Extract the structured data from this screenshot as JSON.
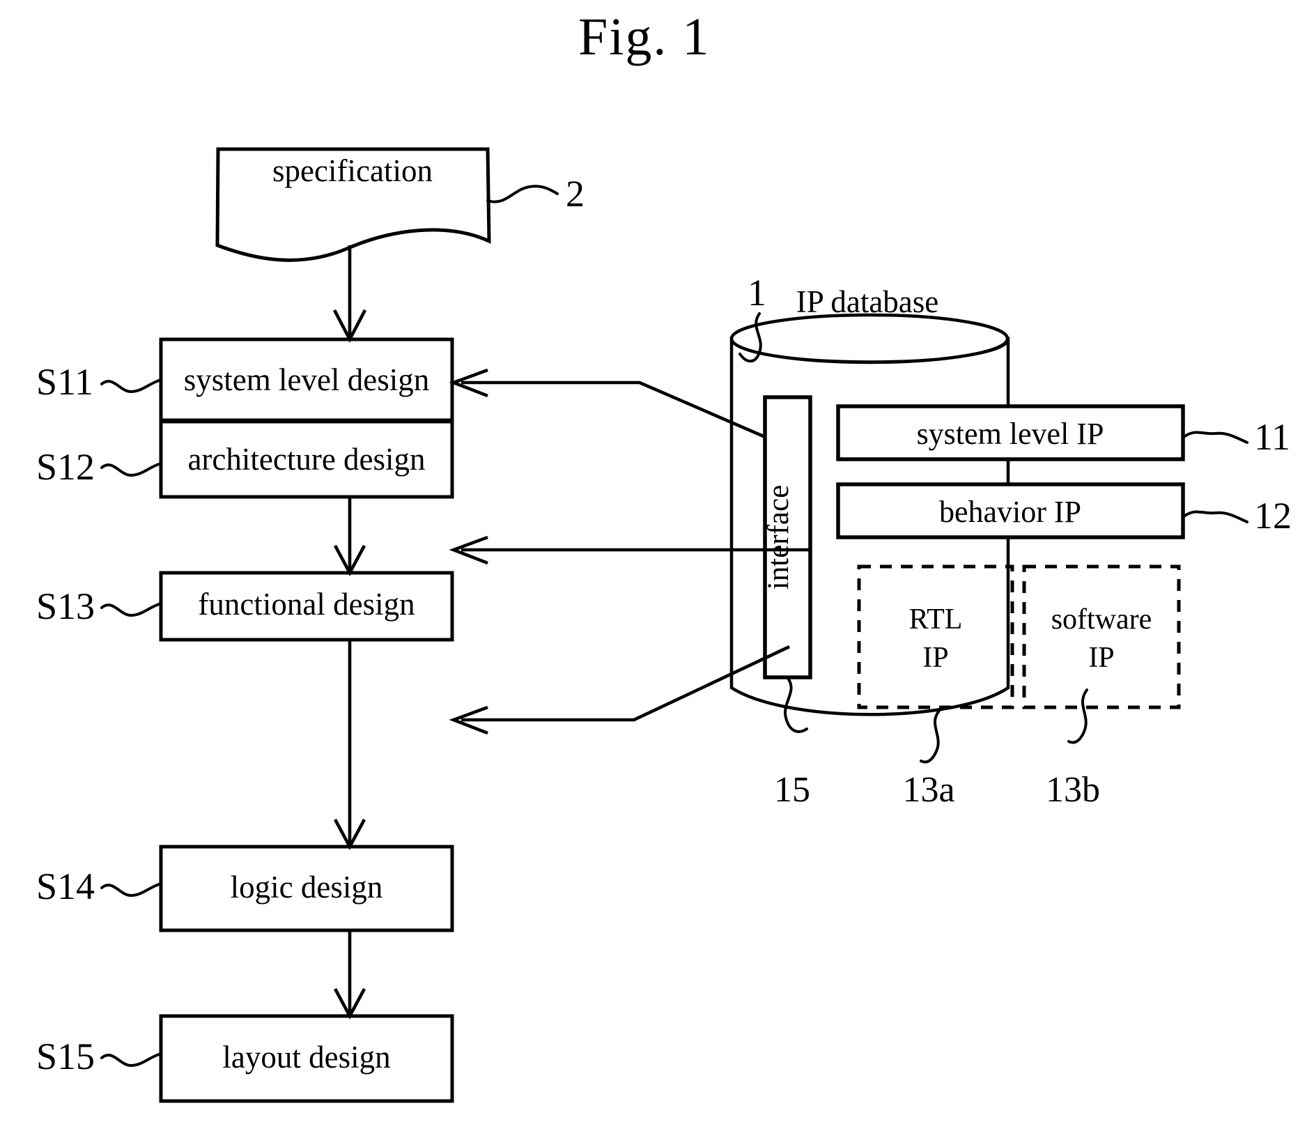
{
  "figure": {
    "title": "Fig. 1",
    "type": "patent-flow-diagram"
  },
  "source_document": {
    "label": "specification",
    "reference": "2"
  },
  "flow_steps": [
    {
      "step_id": "S11",
      "label": "system level design"
    },
    {
      "step_id": "S12",
      "label": "architecture design"
    },
    {
      "step_id": "S13",
      "label": "functional design"
    },
    {
      "step_id": "S14",
      "label": "logic design"
    },
    {
      "step_id": "S15",
      "label": "layout design"
    }
  ],
  "database": {
    "title": "IP database",
    "reference": "1",
    "interface": {
      "label": "interface",
      "reference": "15"
    },
    "solid_items": [
      {
        "label": "system level IP",
        "reference": "11"
      },
      {
        "label": "behavior IP",
        "reference": "12"
      }
    ],
    "dashed_items": [
      {
        "label_line1": "RTL",
        "label_line2": "IP",
        "reference": "13a"
      },
      {
        "label_line1": "software",
        "label_line2": "IP",
        "reference": "13b"
      }
    ]
  },
  "connections": [
    {
      "from": "specification",
      "to": "S11",
      "kind": "arrow-down"
    },
    {
      "from": "S11",
      "to": "S12",
      "kind": "arrow-down"
    },
    {
      "from": "S12",
      "to": "S13",
      "kind": "arrow-down"
    },
    {
      "from": "S13",
      "to": "S14",
      "kind": "arrow-down"
    },
    {
      "from": "S14",
      "to": "S15",
      "kind": "arrow-down"
    },
    {
      "from": "interface",
      "to": "S11",
      "kind": "arrow-left"
    },
    {
      "from": "interface",
      "to": "S12",
      "kind": "arrow-left"
    },
    {
      "from": "interface",
      "to": "S13",
      "kind": "arrow-left"
    }
  ],
  "style": {
    "ink": "#000000",
    "paper": "#ffffff"
  }
}
